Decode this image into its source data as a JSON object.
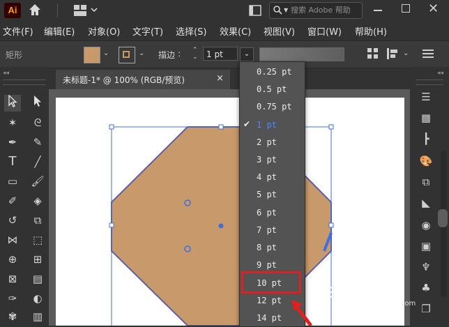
{
  "app": {
    "logo_text": "Ai",
    "search_placeholder": "搜索 Adobe 帮助"
  },
  "menu": {
    "items": [
      "文件(F)",
      "编辑(E)",
      "对象(O)",
      "文字(T)",
      "选择(S)",
      "效果(C)",
      "视图(V)",
      "窗口(W)",
      "帮助(H)"
    ]
  },
  "control_bar": {
    "shape_label": "矩形",
    "stroke_label": "描边",
    "stroke_value": "1 pt",
    "fill_color": "#c8996a"
  },
  "document": {
    "tab_title": "未标题-1* @ 100% (RGB/预览)",
    "close_glyph": "×"
  },
  "shape": {
    "fill_color": "#c8996a",
    "stroke_color": "#5b5fa8"
  },
  "stroke_dropdown": {
    "options": [
      "0.25 pt",
      "0.5 pt",
      "0.75 pt",
      "1 pt",
      "2 pt",
      "3 pt",
      "4 pt",
      "5 pt",
      "6 pt",
      "7 pt",
      "8 pt",
      "9 pt",
      "10 pt",
      "12 pt",
      "14 pt"
    ],
    "selected": "1 pt",
    "highlighted": "10 pt",
    "checkmark": "✔"
  },
  "watermark": {
    "text": "Bai 经验",
    "url": "jingyan.baidu.com"
  },
  "icons": [
    "home-icon",
    "workspace-icon",
    "search-icon",
    "minimize-icon",
    "maximize-icon",
    "close-icon",
    "selection-tool-icon",
    "direct-selection-tool-icon",
    "magic-wand-icon",
    "lasso-icon",
    "pen-icon",
    "curvature-icon",
    "type-icon",
    "line-icon",
    "rectangle-icon",
    "paintbrush-icon",
    "shaper-icon",
    "eraser-icon",
    "rotate-icon",
    "scale-icon",
    "width-icon",
    "free-transform-icon",
    "shape-builder-icon",
    "perspective-icon",
    "mesh-icon",
    "gradient-icon",
    "eyedropper-icon",
    "blend-icon",
    "symbol-sprayer-icon",
    "column-graph-icon"
  ],
  "colors": {
    "accent_blue": "#3c6fe0",
    "highlight_red": "#e02020"
  }
}
